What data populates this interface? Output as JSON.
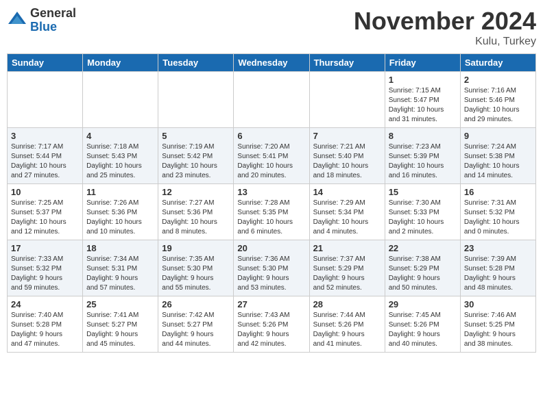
{
  "header": {
    "logo_general": "General",
    "logo_blue": "Blue",
    "month_title": "November 2024",
    "location": "Kulu, Turkey"
  },
  "days_of_week": [
    "Sunday",
    "Monday",
    "Tuesday",
    "Wednesday",
    "Thursday",
    "Friday",
    "Saturday"
  ],
  "weeks": [
    {
      "days": [
        {
          "num": "",
          "info": "",
          "empty": true
        },
        {
          "num": "",
          "info": "",
          "empty": true
        },
        {
          "num": "",
          "info": "",
          "empty": true
        },
        {
          "num": "",
          "info": "",
          "empty": true
        },
        {
          "num": "",
          "info": "",
          "empty": true
        },
        {
          "num": "1",
          "info": "Sunrise: 7:15 AM\nSunset: 5:47 PM\nDaylight: 10 hours\nand 31 minutes.",
          "empty": false
        },
        {
          "num": "2",
          "info": "Sunrise: 7:16 AM\nSunset: 5:46 PM\nDaylight: 10 hours\nand 29 minutes.",
          "empty": false
        }
      ]
    },
    {
      "days": [
        {
          "num": "3",
          "info": "Sunrise: 7:17 AM\nSunset: 5:44 PM\nDaylight: 10 hours\nand 27 minutes.",
          "empty": false
        },
        {
          "num": "4",
          "info": "Sunrise: 7:18 AM\nSunset: 5:43 PM\nDaylight: 10 hours\nand 25 minutes.",
          "empty": false
        },
        {
          "num": "5",
          "info": "Sunrise: 7:19 AM\nSunset: 5:42 PM\nDaylight: 10 hours\nand 23 minutes.",
          "empty": false
        },
        {
          "num": "6",
          "info": "Sunrise: 7:20 AM\nSunset: 5:41 PM\nDaylight: 10 hours\nand 20 minutes.",
          "empty": false
        },
        {
          "num": "7",
          "info": "Sunrise: 7:21 AM\nSunset: 5:40 PM\nDaylight: 10 hours\nand 18 minutes.",
          "empty": false
        },
        {
          "num": "8",
          "info": "Sunrise: 7:23 AM\nSunset: 5:39 PM\nDaylight: 10 hours\nand 16 minutes.",
          "empty": false
        },
        {
          "num": "9",
          "info": "Sunrise: 7:24 AM\nSunset: 5:38 PM\nDaylight: 10 hours\nand 14 minutes.",
          "empty": false
        }
      ]
    },
    {
      "days": [
        {
          "num": "10",
          "info": "Sunrise: 7:25 AM\nSunset: 5:37 PM\nDaylight: 10 hours\nand 12 minutes.",
          "empty": false
        },
        {
          "num": "11",
          "info": "Sunrise: 7:26 AM\nSunset: 5:36 PM\nDaylight: 10 hours\nand 10 minutes.",
          "empty": false
        },
        {
          "num": "12",
          "info": "Sunrise: 7:27 AM\nSunset: 5:36 PM\nDaylight: 10 hours\nand 8 minutes.",
          "empty": false
        },
        {
          "num": "13",
          "info": "Sunrise: 7:28 AM\nSunset: 5:35 PM\nDaylight: 10 hours\nand 6 minutes.",
          "empty": false
        },
        {
          "num": "14",
          "info": "Sunrise: 7:29 AM\nSunset: 5:34 PM\nDaylight: 10 hours\nand 4 minutes.",
          "empty": false
        },
        {
          "num": "15",
          "info": "Sunrise: 7:30 AM\nSunset: 5:33 PM\nDaylight: 10 hours\nand 2 minutes.",
          "empty": false
        },
        {
          "num": "16",
          "info": "Sunrise: 7:31 AM\nSunset: 5:32 PM\nDaylight: 10 hours\nand 0 minutes.",
          "empty": false
        }
      ]
    },
    {
      "days": [
        {
          "num": "17",
          "info": "Sunrise: 7:33 AM\nSunset: 5:32 PM\nDaylight: 9 hours\nand 59 minutes.",
          "empty": false
        },
        {
          "num": "18",
          "info": "Sunrise: 7:34 AM\nSunset: 5:31 PM\nDaylight: 9 hours\nand 57 minutes.",
          "empty": false
        },
        {
          "num": "19",
          "info": "Sunrise: 7:35 AM\nSunset: 5:30 PM\nDaylight: 9 hours\nand 55 minutes.",
          "empty": false
        },
        {
          "num": "20",
          "info": "Sunrise: 7:36 AM\nSunset: 5:30 PM\nDaylight: 9 hours\nand 53 minutes.",
          "empty": false
        },
        {
          "num": "21",
          "info": "Sunrise: 7:37 AM\nSunset: 5:29 PM\nDaylight: 9 hours\nand 52 minutes.",
          "empty": false
        },
        {
          "num": "22",
          "info": "Sunrise: 7:38 AM\nSunset: 5:29 PM\nDaylight: 9 hours\nand 50 minutes.",
          "empty": false
        },
        {
          "num": "23",
          "info": "Sunrise: 7:39 AM\nSunset: 5:28 PM\nDaylight: 9 hours\nand 48 minutes.",
          "empty": false
        }
      ]
    },
    {
      "days": [
        {
          "num": "24",
          "info": "Sunrise: 7:40 AM\nSunset: 5:28 PM\nDaylight: 9 hours\nand 47 minutes.",
          "empty": false
        },
        {
          "num": "25",
          "info": "Sunrise: 7:41 AM\nSunset: 5:27 PM\nDaylight: 9 hours\nand 45 minutes.",
          "empty": false
        },
        {
          "num": "26",
          "info": "Sunrise: 7:42 AM\nSunset: 5:27 PM\nDaylight: 9 hours\nand 44 minutes.",
          "empty": false
        },
        {
          "num": "27",
          "info": "Sunrise: 7:43 AM\nSunset: 5:26 PM\nDaylight: 9 hours\nand 42 minutes.",
          "empty": false
        },
        {
          "num": "28",
          "info": "Sunrise: 7:44 AM\nSunset: 5:26 PM\nDaylight: 9 hours\nand 41 minutes.",
          "empty": false
        },
        {
          "num": "29",
          "info": "Sunrise: 7:45 AM\nSunset: 5:26 PM\nDaylight: 9 hours\nand 40 minutes.",
          "empty": false
        },
        {
          "num": "30",
          "info": "Sunrise: 7:46 AM\nSunset: 5:25 PM\nDaylight: 9 hours\nand 38 minutes.",
          "empty": false
        }
      ]
    }
  ]
}
